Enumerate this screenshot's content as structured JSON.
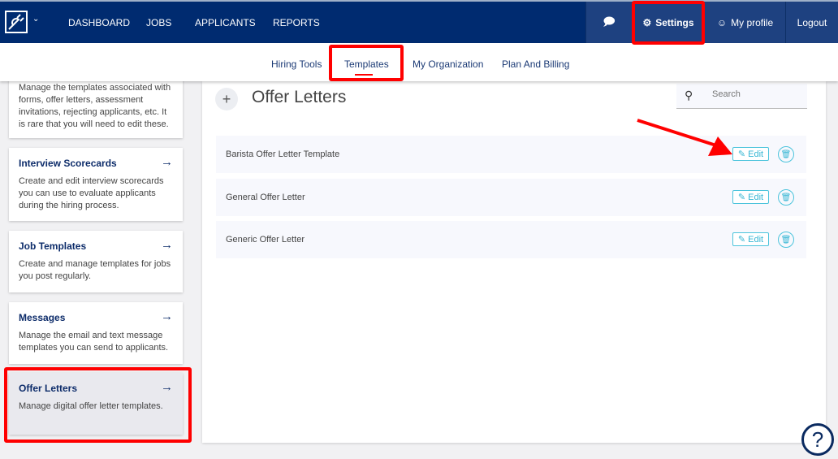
{
  "nav": {
    "links": [
      "DASHBOARD",
      "JOBS",
      "APPLICANTS",
      "REPORTS"
    ],
    "settings": "Settings",
    "profile": "My profile",
    "logout": "Logout"
  },
  "subnav": [
    "Hiring Tools",
    "Templates",
    "My Organization",
    "Plan And Billing"
  ],
  "sidebar": [
    {
      "title": "",
      "desc": "Manage the templates associated with forms, offer letters, assessment invitations, rejecting applicants, etc. It is rare that you will need to edit these."
    },
    {
      "title": "Interview Scorecards",
      "desc": "Create and edit interview scorecards you can use to evaluate applicants during the hiring process."
    },
    {
      "title": "Job Templates",
      "desc": "Create and manage templates for jobs you post regularly."
    },
    {
      "title": "Messages",
      "desc": "Manage the email and text message templates you can send to applicants."
    },
    {
      "title": "Offer Letters",
      "desc": "Manage digital offer letter templates."
    }
  ],
  "main": {
    "title": "Offer Letters",
    "search_placeholder": "Search",
    "edit_label": "Edit",
    "rows": [
      "Barista Offer Letter Template",
      "General Offer Letter",
      "Generic Offer Letter"
    ]
  },
  "help": "?"
}
